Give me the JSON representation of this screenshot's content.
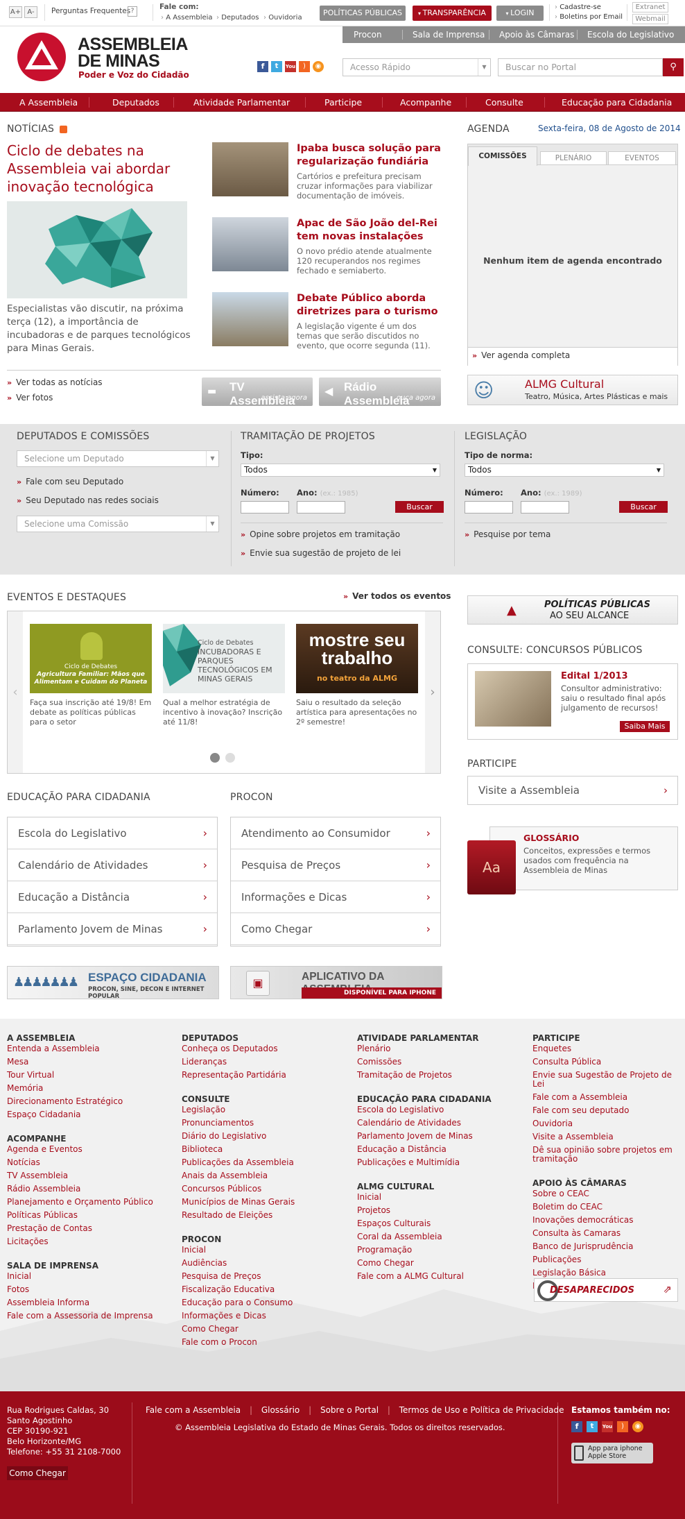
{
  "topbar": {
    "font_up": "A+",
    "font_down": "A-",
    "faq_label": "Perguntas Frequentes",
    "faq_icon": "?",
    "fale_com_label": "Fale com:",
    "fale_links": [
      "A Assembleia",
      "Deputados",
      "Ouvidoria"
    ],
    "btn_politicas": "POLÍTICAS PÚBLICAS",
    "btn_transparencia": "TRANSPARÊNCIA",
    "btn_login": "LOGIN",
    "cadastre_se": "Cadastre-se",
    "boletins": "Boletins por Email",
    "extranet": "Extranet",
    "webmail": "Webmail"
  },
  "secbar": {
    "items": [
      "Procon",
      "Sala de Imprensa",
      "Apoio às Câmaras",
      "Escola do Legislativo"
    ]
  },
  "header": {
    "logo_line1": "ASSEMBLEIA",
    "logo_line2": "DE MINAS",
    "logo_tagline": "Poder e Voz do Cidadão",
    "quick_access_placeholder": "Acesso Rápido",
    "search_placeholder": "Buscar no Portal",
    "social_icons": [
      "facebook-icon",
      "twitter-icon",
      "youtube-icon",
      "rss-icon",
      "podcast-icon"
    ]
  },
  "nav": {
    "items": [
      "A Assembleia",
      "Deputados",
      "Atividade Parlamentar",
      "Participe",
      "Acompanhe",
      "Consulte",
      "Educação para Cidadania"
    ]
  },
  "news": {
    "section_title": "NOTÍCIAS",
    "main_title": "Ciclo de debates na Assembleia vai abordar inovação tecnológica",
    "main_text": "Especialistas vão discutir, na próxima terça (12), a importância de incubadoras e de parques tecnológicos para Minas Gerais.",
    "items": [
      {
        "title": "Ipaba busca solução para regularização fundiária",
        "text": "Cartórios e prefeitura precisam cruzar informações para viabilizar documentação de imóveis."
      },
      {
        "title": "Apac de São João del-Rei tem novas instalações",
        "text": "O novo prédio atende atualmente 120 recuperandos nos regimes fechado e semiaberto."
      },
      {
        "title": "Debate Público aborda diretrizes para o turismo",
        "text": "A legislação vigente é um dos temas que serão discutidos no evento, que ocorre segunda (11)."
      }
    ],
    "link_all": "Ver todas as notícias",
    "link_photos": "Ver fotos",
    "tv_title": "TV Assembleia",
    "tv_sub": "assista agora",
    "radio_title": "Rádio Assembleia",
    "radio_sub": "ouça agora"
  },
  "agenda": {
    "title": "AGENDA",
    "date": "Sexta-feira, 08 de Agosto de 2014",
    "tabs": [
      "COMISSÕES",
      "PLENÁRIO",
      "EVENTOS"
    ],
    "empty": "Nenhum item de agenda encontrado",
    "full_link": "Ver agenda completa",
    "cultural_title": "ALMG Cultural",
    "cultural_sub": "Teatro, Música, Artes Plásticas e mais"
  },
  "tools": {
    "deputados": {
      "title": "DEPUTADOS E COMISSÕES",
      "select_deputado": "Selecione um Deputado",
      "link1": "Fale com seu Deputado",
      "link2": "Seu Deputado nas redes sociais",
      "select_comissao": "Selecione uma Comissão"
    },
    "tramitacao": {
      "title": "TRAMITAÇÃO DE PROJETOS",
      "tipo_label": "Tipo:",
      "tipo_value": "Todos",
      "numero_label": "Número:",
      "ano_label": "Ano:",
      "ano_hint": "(ex.: 1985)",
      "buscar": "Buscar",
      "link1": "Opine sobre projetos em tramitação",
      "link2": "Envie sua sugestão de projeto de lei"
    },
    "legislacao": {
      "title": "LEGISLAÇÃO",
      "tipo_label": "Tipo de norma:",
      "tipo_value": "Todos",
      "numero_label": "Número:",
      "ano_label": "Ano:",
      "ano_hint": "(ex.: 1989)",
      "buscar": "Buscar",
      "link1": "Pesquise por tema"
    }
  },
  "eventos": {
    "title": "EVENTOS E DESTAQUES",
    "see_all": "Ver todos os eventos",
    "cards": [
      {
        "img_title": "Ciclo de Debates",
        "img_text": "Agricultura Familiar: Mãos que Alimentam e Cuidam do Planeta",
        "text": "Faça sua inscrição até 19/8! Em debate as políticas públicas para o setor"
      },
      {
        "img_title": "Ciclo de Debates",
        "img_text": "INCUBADORAS E PARQUES TECNOLÓGICOS EM MINAS GERAIS",
        "text": "Qual a melhor estratégia de incentivo à inovação? Inscrição até 11/8!"
      },
      {
        "img_title": "mostre seu trabalho",
        "img_text": "no teatro da ALMG",
        "text": "Saiu o resultado da seleção artística para apresentações no 2º semestre!"
      }
    ]
  },
  "politicas_banner": {
    "line1": "POLÍTICAS PÚBLICAS",
    "line2": "AO SEU ALCANCE"
  },
  "concursos": {
    "title": "CONSULTE: CONCURSOS PÚBLICOS",
    "edital": "Edital 1/2013",
    "text": "Consultor administrativo: saiu o resultado final após julgamento de recursos!",
    "btn": "Saiba Mais"
  },
  "participe": {
    "title": "PARTICIPE",
    "visit": "Visite a Assembleia"
  },
  "glossario": {
    "title": "GLOSSÁRIO",
    "text": "Conceitos, expressões e termos usados com frequência na Assembleia de Minas"
  },
  "educacao": {
    "title": "EDUCAÇÃO PARA CIDADANIA",
    "items": [
      "Escola do Legislativo",
      "Calendário de Atividades",
      "Educação a Distância",
      "Parlamento Jovem de Minas"
    ]
  },
  "procon": {
    "title": "PROCON",
    "items": [
      "Atendimento ao Consumidor",
      "Pesquisa de Preços",
      "Informações e Dicas",
      "Como Chegar"
    ]
  },
  "banners": {
    "espaco_title": "ESPAÇO CIDADANIA",
    "espaco_sub": "PROCON, SINE, DECON E INTERNET POPULAR",
    "app_title": "APLICATIVO DA ASSEMBLEIA",
    "app_sub": "DISPONÍVEL PARA IPHONE"
  },
  "footer": {
    "col1": [
      {
        "head": "A ASSEMBLEIA",
        "items": [
          "Entenda a Assembleia",
          "Mesa",
          "Tour Virtual",
          "Memória",
          "Direcionamento Estratégico",
          "Espaço Cidadania"
        ]
      },
      {
        "head": "ACOMPANHE",
        "items": [
          "Agenda e Eventos",
          "Notícias",
          "TV Assembleia",
          "Rádio Assembleia",
          "Planejamento e Orçamento Público",
          "Políticas Públicas",
          "Prestação de Contas",
          "Licitações"
        ]
      },
      {
        "head": "SALA DE IMPRENSA",
        "items": [
          "Inicial",
          "Fotos",
          "Assembleia Informa",
          "Fale com a Assessoria de Imprensa"
        ]
      }
    ],
    "col2": [
      {
        "head": "DEPUTADOS",
        "items": [
          "Conheça os Deputados",
          "Lideranças",
          "Representação Partidária"
        ]
      },
      {
        "head": "CONSULTE",
        "items": [
          "Legislação",
          "Pronunciamentos",
          "Diário do Legislativo",
          "Biblioteca",
          "Publicações da Assembleia",
          "Anais da Assembleia",
          "Concursos Públicos",
          "Municípios de Minas Gerais",
          "Resultado de Eleições"
        ]
      },
      {
        "head": "PROCON",
        "items": [
          "Inicial",
          "Audiências",
          "Pesquisa de Preços",
          "Fiscalização Educativa",
          "Educação para o Consumo",
          "Informações e Dicas",
          "Como Chegar",
          "Fale com o Procon"
        ]
      }
    ],
    "col3": [
      {
        "head": "ATIVIDADE PARLAMENTAR",
        "items": [
          "Plenário",
          "Comissões",
          "Tramitação de Projetos"
        ]
      },
      {
        "head": "EDUCAÇÃO PARA CIDADANIA",
        "items": [
          "Escola do Legislativo",
          "Calendário de Atividades",
          "Parlamento Jovem de Minas",
          "Educação a Distância",
          "Publicações e Multimídia"
        ]
      },
      {
        "head": "ALMG CULTURAL",
        "items": [
          "Inicial",
          "Projetos",
          "Espaços Culturais",
          "Coral da Assembleia",
          "Programação",
          "Como Chegar",
          "Fale com a ALMG Cultural"
        ]
      }
    ],
    "col4": [
      {
        "head": "PARTICIPE",
        "items": [
          "Enquetes",
          "Consulta Pública",
          "Envie sua Sugestão de Projeto de Lei",
          "Fale com a Assembleia",
          "Fale com seu deputado",
          "Ouvidoria",
          "Visite a Assembleia",
          "Dê sua opinião sobre projetos em tramitação"
        ]
      },
      {
        "head": "APOIO ÀS CÂMARAS",
        "items": [
          "Sobre o CEAC",
          "Boletim do CEAC",
          "Inovações democráticas",
          "Consulta às Camaras",
          "Banco de Jurisprudência",
          "Publicações",
          "Legislação Básica",
          "Fale com o Ceac"
        ]
      }
    ],
    "desaparecidos": "DESAPARECIDOS"
  },
  "bottom": {
    "address": [
      "Rua Rodrigues Caldas, 30",
      "Santo Agostinho",
      "CEP 30190-921",
      "Belo Horizonte/MG",
      "Telefone: +55 31 2108-7000"
    ],
    "como_chegar": "Como Chegar",
    "links": [
      "Fale com a Assembleia",
      "Glossário",
      "Sobre o Portal",
      "Termos de Uso e Política de Privacidade"
    ],
    "copyright": "© Assembleia Legislativa do Estado de Minas Gerais. Todos os direitos reservados.",
    "social_title": "Estamos também no:",
    "app_store_line1": "App para iphone",
    "app_store_line2": "Apple Store"
  },
  "colors": {
    "brand_red": "#a70d1c",
    "grey_band": "#e5e5e5",
    "footer_bg": "#f1f1f1"
  }
}
